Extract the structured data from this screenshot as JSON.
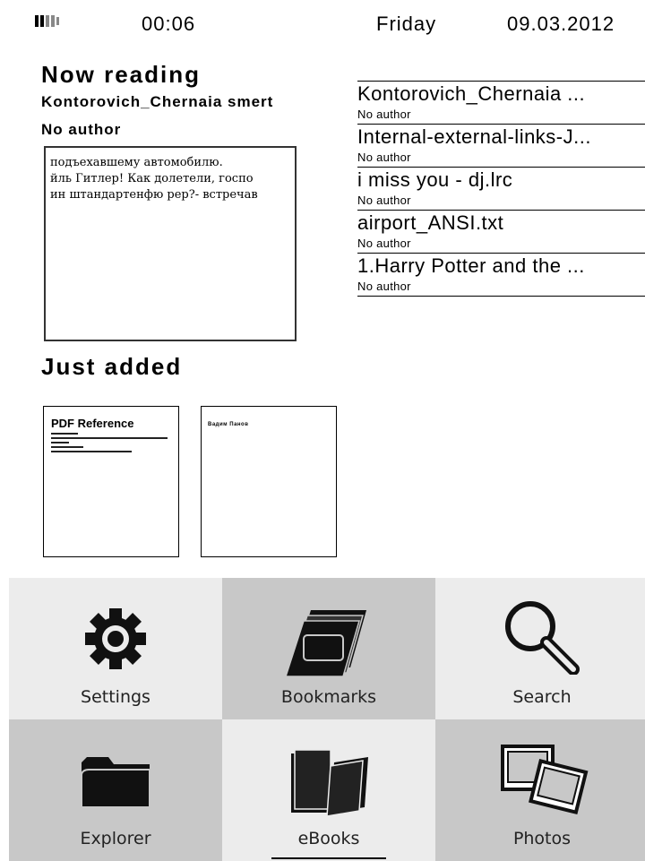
{
  "status_bar": {
    "time": "00:06",
    "day": "Friday",
    "date": "09.03.2012"
  },
  "now_reading": {
    "heading": "Now reading",
    "title": "Kontorovich_Chernaia smert",
    "author": "No author",
    "preview_lines": [
      "подъехавшему автомобилю.",
      "йль Гитлер! Как долетели, госпо",
      "ин штандартенфю рер?- встречав"
    ]
  },
  "recent_books": [
    {
      "title": "Kontorovich_Chernaia ...",
      "author": "No author"
    },
    {
      "title": "Internal-external-links-J...",
      "author": "No author"
    },
    {
      "title": "i miss you - dj.lrc",
      "author": "No author"
    },
    {
      "title": "airport_ANSI.txt",
      "author": "No author"
    },
    {
      "title": "1.Harry Potter and the ...",
      "author": "No author"
    }
  ],
  "just_added": {
    "heading": "Just added",
    "items": [
      {
        "cover_title": "PDF Reference"
      },
      {
        "cover_title": "Вадим Панов"
      }
    ]
  },
  "menu": {
    "settings": "Settings",
    "bookmarks": "Bookmarks",
    "search": "Search",
    "explorer": "Explorer",
    "ebooks": "eBooks",
    "photos": "Photos"
  },
  "icons": {
    "battery": "battery-icon",
    "settings": "gear-icon",
    "bookmarks": "books-stack-icon",
    "search": "magnifier-icon",
    "explorer": "folder-icon",
    "ebooks": "open-book-icon",
    "photos": "photos-icon"
  },
  "colors": {
    "tile_light": "#ececec",
    "tile_dark": "#c8c8c8",
    "text": "#000000"
  }
}
